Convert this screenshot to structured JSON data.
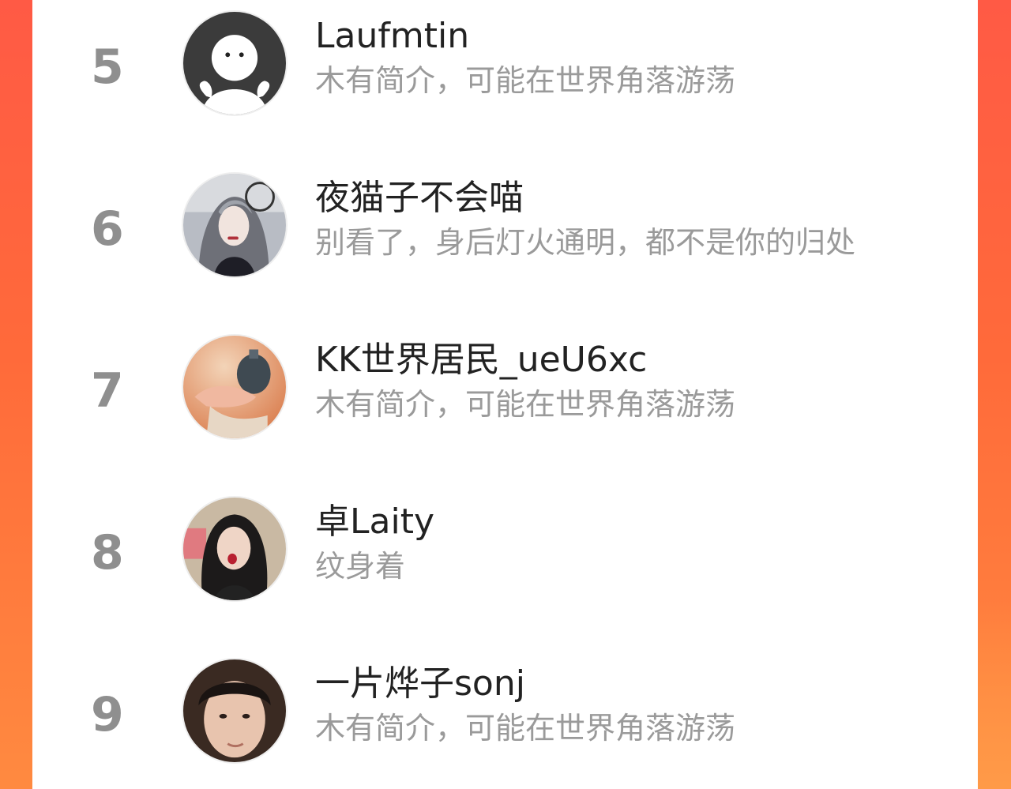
{
  "colors": {
    "background_left": "#ff5a45",
    "background_right": "#ff8a40",
    "panel": "#ffffff",
    "rank_text": "#8f8f8f",
    "name_text": "#222222",
    "bio_text": "#9a9a9a"
  },
  "users": [
    {
      "rank": "5",
      "name": "Laufmtin",
      "bio": "木有简介，可能在世界角落游荡",
      "avatar": "default-avatar-icon"
    },
    {
      "rank": "6",
      "name": "夜猫子不会喵",
      "bio": "别看了，身后灯火通明，都不是你的归处",
      "avatar": "illustrated-girl-avatar"
    },
    {
      "rank": "7",
      "name": "KK世界居民_ueU6xc",
      "bio": "木有简介，可能在世界角落游荡",
      "avatar": "vase-photo-avatar"
    },
    {
      "rank": "8",
      "name": "卓Laity",
      "bio": "纹身着",
      "avatar": "girl-photo-avatar"
    },
    {
      "rank": "9",
      "name": "一片烨子sonj",
      "bio": "木有简介，可能在世界角落游荡",
      "avatar": "boy-photo-avatar"
    }
  ]
}
